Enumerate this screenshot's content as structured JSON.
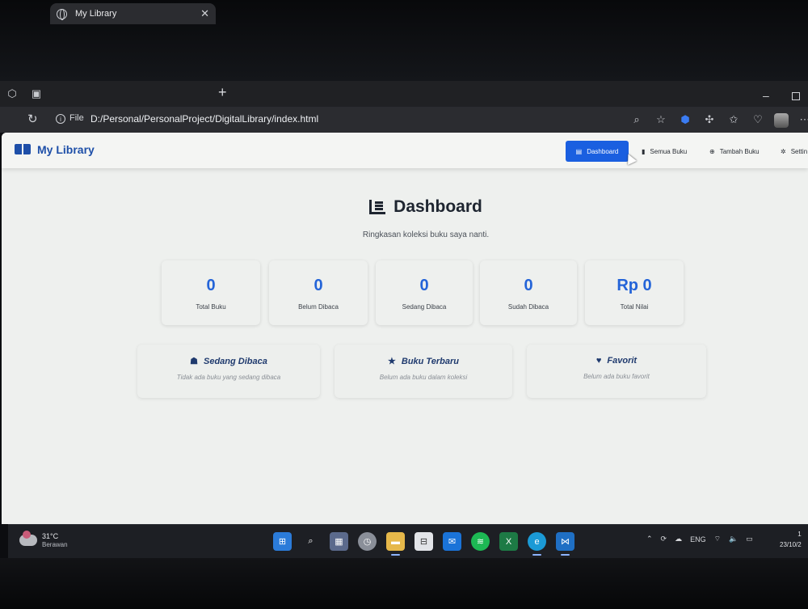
{
  "browser": {
    "tab_title": "My Library",
    "file_label": "File",
    "url": "D:/Personal/PersonalProject/DigitalLibrary/index.html",
    "new_tab": "+",
    "close_tab": "✕"
  },
  "navbar": {
    "brand": "My Library",
    "items": [
      {
        "label": "Dashboard",
        "icon": "chart-icon",
        "active": true
      },
      {
        "label": "Semua Buku",
        "icon": "book-icon"
      },
      {
        "label": "Tambah Buku",
        "icon": "plus-circle-icon"
      },
      {
        "label": "Settin",
        "icon": "gear-icon"
      }
    ],
    "accent": "#1a5fe0"
  },
  "dashboard": {
    "title": "Dashboard",
    "subtitle": "Ringkasan koleksi buku saya nanti.",
    "stats": [
      {
        "value": "0",
        "label": "Total Buku"
      },
      {
        "value": "0",
        "label": "Belum Dibaca"
      },
      {
        "value": "0",
        "label": "Sedang Dibaca"
      },
      {
        "value": "0",
        "label": "Sudah Dibaca"
      },
      {
        "value": "Rp 0",
        "label": "Total Nilai"
      }
    ],
    "panels": [
      {
        "title": "Sedang Dibaca",
        "icon": "reader-icon",
        "empty": "Tidak ada buku yang sedang dibaca"
      },
      {
        "title": "Buku Terbaru",
        "icon": "star-icon",
        "empty": "Belum ada buku dalam koleksi"
      },
      {
        "title": "Favorit",
        "icon": "heart-icon",
        "empty": "Belum ada buku favorit"
      }
    ]
  },
  "taskbar": {
    "temperature": "31°C",
    "condition": "Berawan",
    "language": "ENG",
    "time": "1",
    "date": "23/10/2"
  }
}
